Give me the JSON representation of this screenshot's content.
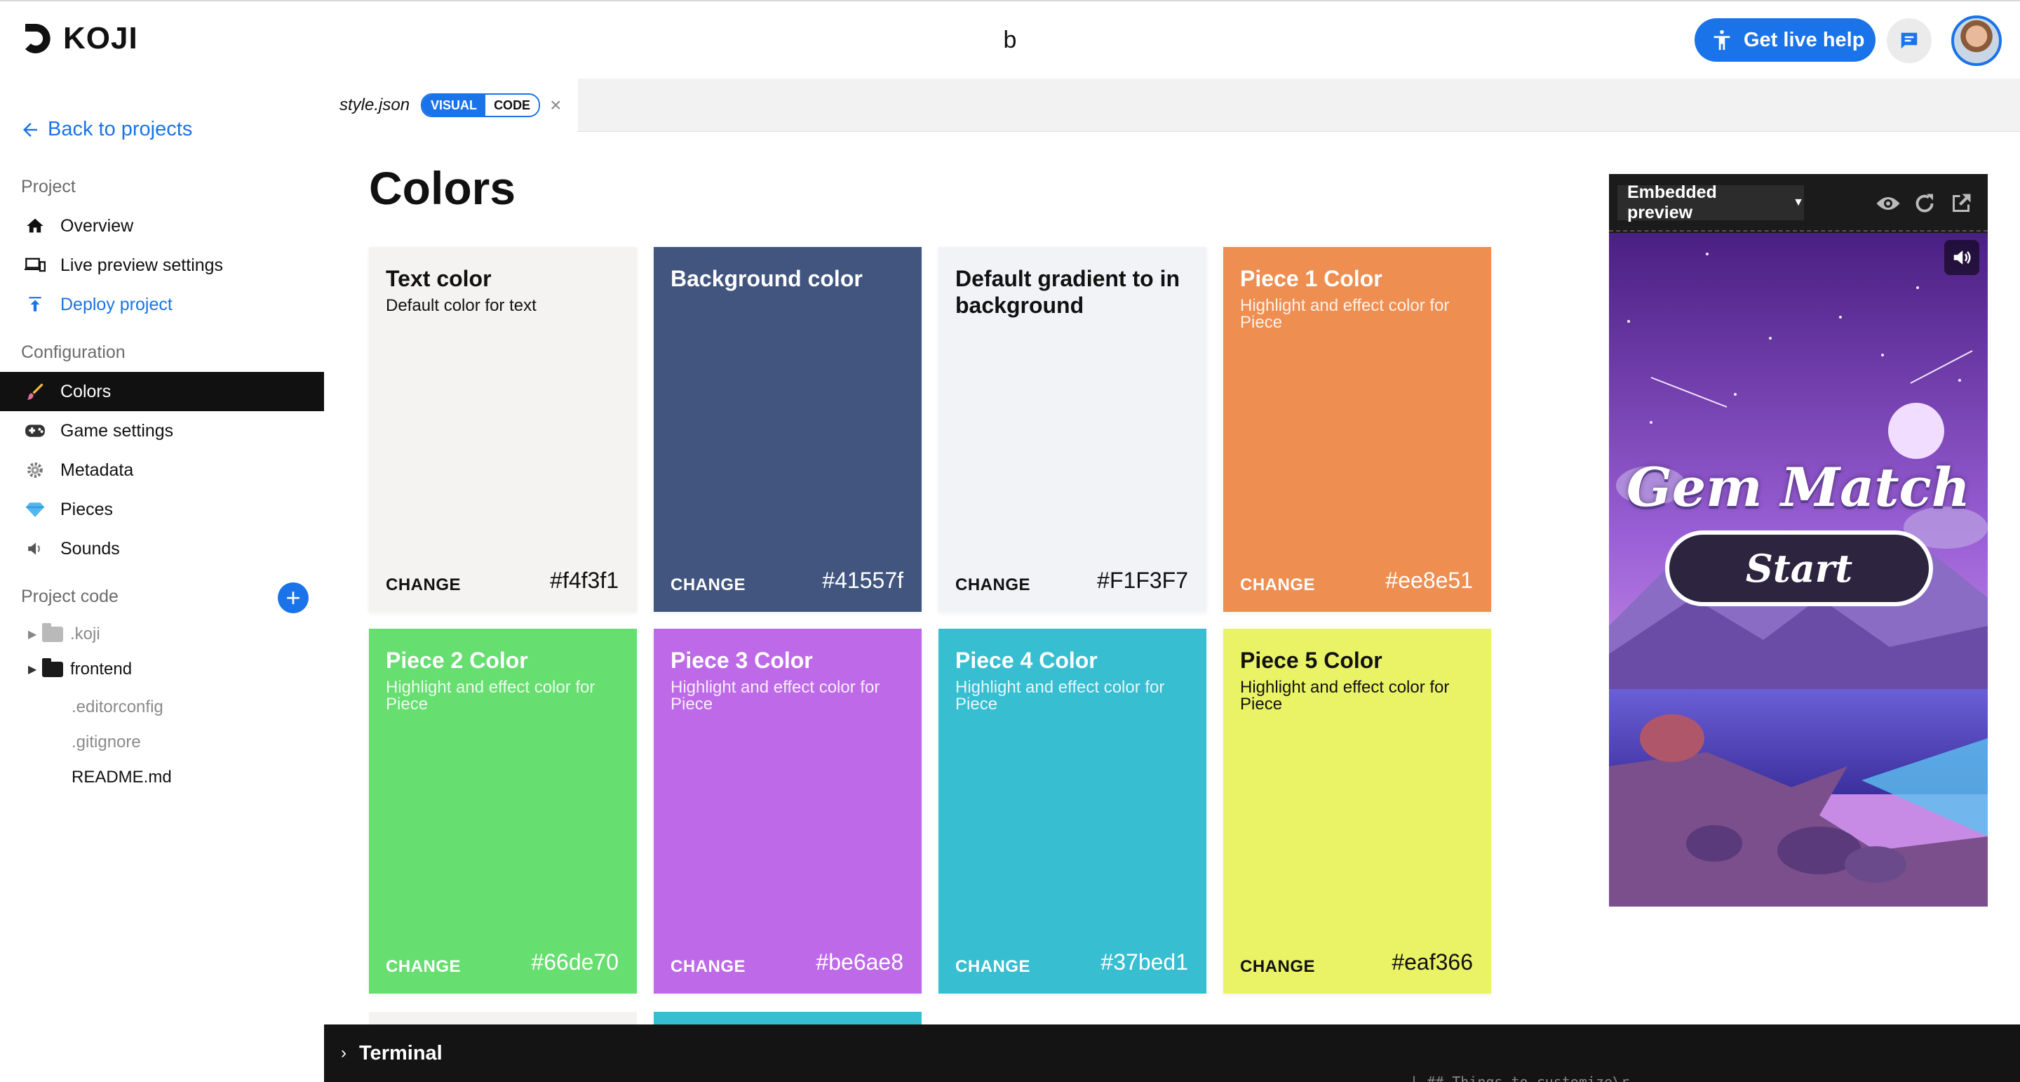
{
  "header": {
    "logo_text": "KOJI",
    "project_name": "b",
    "help_label": "Get live help"
  },
  "sidebar": {
    "back_label": "Back to projects",
    "project_section": "Project",
    "project_items": [
      {
        "label": "Overview",
        "icon": "home-icon"
      },
      {
        "label": "Live preview settings",
        "icon": "devices-icon"
      },
      {
        "label": "Deploy project",
        "icon": "upload-icon"
      }
    ],
    "config_section": "Configuration",
    "config_items": [
      {
        "label": "Colors",
        "icon": "palette-icon",
        "active": true
      },
      {
        "label": "Game settings",
        "icon": "gamepad-icon"
      },
      {
        "label": "Metadata",
        "icon": "gear-icon"
      },
      {
        "label": "Pieces",
        "icon": "gem-icon"
      },
      {
        "label": "Sounds",
        "icon": "speaker-icon"
      }
    ],
    "code_section": "Project code",
    "tree": [
      {
        "label": ".koji",
        "type": "folder"
      },
      {
        "label": "frontend",
        "type": "folder"
      },
      {
        "label": ".editorconfig",
        "type": "file"
      },
      {
        "label": ".gitignore",
        "type": "file"
      },
      {
        "label": "README.md",
        "type": "file"
      }
    ]
  },
  "tab": {
    "file": "style.json",
    "visual_label": "VISUAL",
    "code_label": "CODE"
  },
  "page": {
    "title": "Colors"
  },
  "cards": [
    {
      "title": "Text color",
      "desc": "Default color for text",
      "change": "CHANGE",
      "hex": "#f4f3f1",
      "bg": "#f4f3f1",
      "fg": "#111111"
    },
    {
      "title": "Background color",
      "desc": "",
      "change": "CHANGE",
      "hex": "#41557f",
      "bg": "#41557f",
      "fg": "#ffffff"
    },
    {
      "title": "Default gradient to in background",
      "desc": "",
      "change": "CHANGE",
      "hex": "#F1F3F7",
      "bg": "#f1f3f7",
      "fg": "#111111"
    },
    {
      "title": "Piece 1 Color",
      "desc": "Highlight and effect color for Piece",
      "change": "CHANGE",
      "hex": "#ee8e51",
      "bg": "#ee8e51",
      "fg": "#ffffff"
    },
    {
      "title": "Piece 2 Color",
      "desc": "Highlight and effect color for Piece",
      "change": "CHANGE",
      "hex": "#66de70",
      "bg": "#66de70",
      "fg": "#ffffff"
    },
    {
      "title": "Piece 3 Color",
      "desc": "Highlight and effect color for Piece",
      "change": "CHANGE",
      "hex": "#be6ae8",
      "bg": "#be6ae8",
      "fg": "#ffffff"
    },
    {
      "title": "Piece 4 Color",
      "desc": "Highlight and effect color for Piece",
      "change": "CHANGE",
      "hex": "#37bed1",
      "bg": "#37bed1",
      "fg": "#ffffff"
    },
    {
      "title": "Piece 5 Color",
      "desc": "Highlight and effect color for Piece",
      "change": "CHANGE",
      "hex": "#eaf366",
      "bg": "#eaf366",
      "fg": "#111111"
    }
  ],
  "preview": {
    "select_label": "Embedded preview",
    "game_title": "Gem Match",
    "start_label": "Start"
  },
  "terminal": {
    "label": "Terminal",
    "peek_text": "| ## Things to customize\\r"
  },
  "colors": {
    "accent": "#1a73e8",
    "active_nav": "#111111"
  }
}
